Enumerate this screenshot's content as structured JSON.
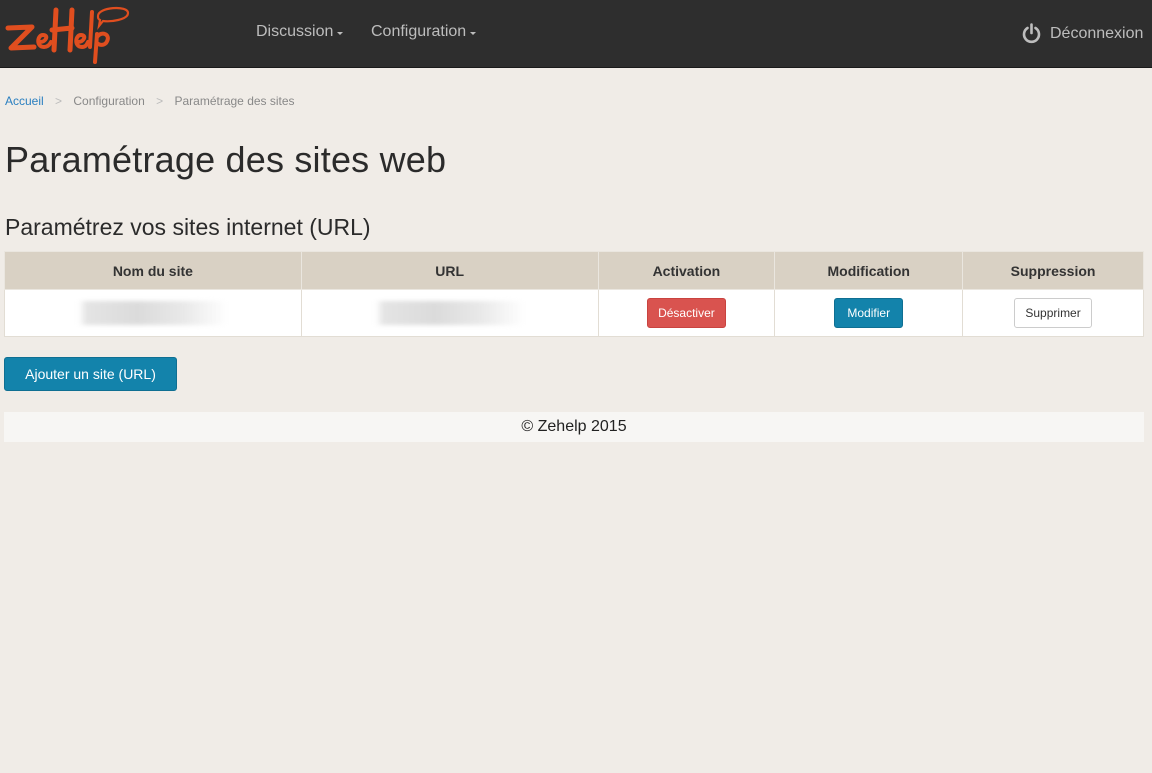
{
  "app": {
    "logo_text": "ZeHelp",
    "brand_color": "#e04e1f"
  },
  "nav": {
    "items": [
      {
        "label": "Discussion",
        "icon": "caret-down-icon"
      },
      {
        "label": "Configuration",
        "icon": "caret-down-icon"
      }
    ],
    "logout": {
      "label": "Déconnexion",
      "icon": "power-icon"
    }
  },
  "breadcrumb": {
    "items": [
      "Accueil",
      "Configuration",
      "Paramétrage des sites"
    ],
    "separator": ">"
  },
  "page": {
    "title": "Paramétrage des sites web",
    "section_title": "Paramétrez vos sites internet (URL)"
  },
  "table": {
    "headers": [
      "Nom du site",
      "URL",
      "Activation",
      "Modification",
      "Suppression"
    ],
    "rows": [
      {
        "name": "",
        "url": "",
        "activation_label": "Désactiver",
        "modify_label": "Modifier",
        "delete_label": "Supprimer"
      }
    ]
  },
  "actions": {
    "add_site_label": "Ajouter un site (URL)"
  },
  "footer": {
    "text": "© Zehelp 2015"
  },
  "colors": {
    "navbar_bg": "#2e2e2e",
    "page_bg": "#f0ece7",
    "table_header_bg": "#d9d1c4",
    "primary": "#1383ab",
    "danger": "#d9534f",
    "link": "#2a7fc0"
  }
}
